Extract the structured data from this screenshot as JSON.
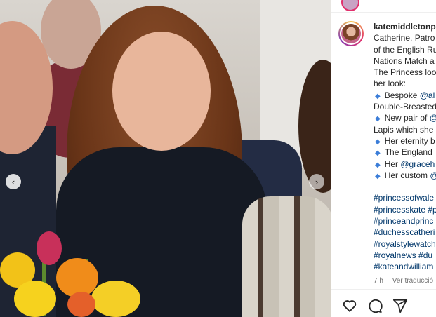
{
  "post": {
    "username": "katemiddletonp",
    "caption_lines": [
      "Catherine, Patro",
      "of the English Ru",
      "Nations Match a",
      "The Princess loo",
      "her look:"
    ],
    "bullets": [
      {
        "prefix": "Bespoke ",
        "mention": "@al",
        "rest": ""
      },
      {
        "prefix": "",
        "mention": "",
        "rest": "Double-Breasted",
        "plain": true
      },
      {
        "prefix": "New pair of ",
        "mention": "@",
        "rest": ""
      },
      {
        "prefix": "",
        "mention": "",
        "rest": "Lapis which she",
        "plain": true
      },
      {
        "prefix": "Her eternity b",
        "mention": "",
        "rest": ""
      },
      {
        "prefix": "The England",
        "mention": "",
        "rest": ""
      },
      {
        "prefix": "Her ",
        "mention": "@graceh",
        "rest": ""
      },
      {
        "prefix": "Her custom ",
        "mention": "@",
        "rest": ""
      }
    ],
    "hashtags": [
      "#princessofwale",
      "#princesskate #p",
      "#princeandprinc",
      "#duchesscatheri",
      "#royalstylewatch",
      "#royalnews #du",
      "#kateandwilliam"
    ],
    "time_ago": "7 h",
    "see_translation": "Ver traducció"
  },
  "icons": [
    "heart-icon",
    "comment-icon",
    "share-icon",
    "chevron-left-icon",
    "chevron-right-icon"
  ],
  "colors": {
    "link": "#00376b",
    "bullet": "#3b7dd8",
    "meta": "#737373"
  }
}
